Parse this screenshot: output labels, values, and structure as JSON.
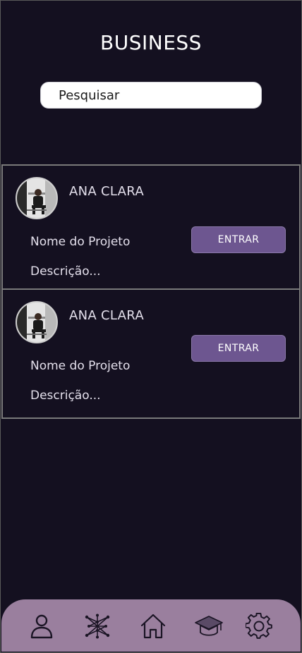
{
  "header": {
    "title": "BUSINESS"
  },
  "search": {
    "placeholder": "Pesquisar"
  },
  "cards": [
    {
      "author": "ANA CLARA",
      "project": "Nome do Projeto",
      "description": "Descrição...",
      "button_label": "ENTRAR"
    },
    {
      "author": "ANA CLARA",
      "project": "Nome do Projeto",
      "description": "Descrição...",
      "button_label": "ENTRAR"
    }
  ],
  "bottom_nav": {
    "items": [
      {
        "icon": "user-icon"
      },
      {
        "icon": "network-icon"
      },
      {
        "icon": "home-icon"
      },
      {
        "icon": "graduation-cap-icon"
      },
      {
        "icon": "gear-icon"
      }
    ]
  },
  "colors": {
    "background": "#141020",
    "accent_button": "#6d5690",
    "nav_background": "#9a7f9e"
  }
}
